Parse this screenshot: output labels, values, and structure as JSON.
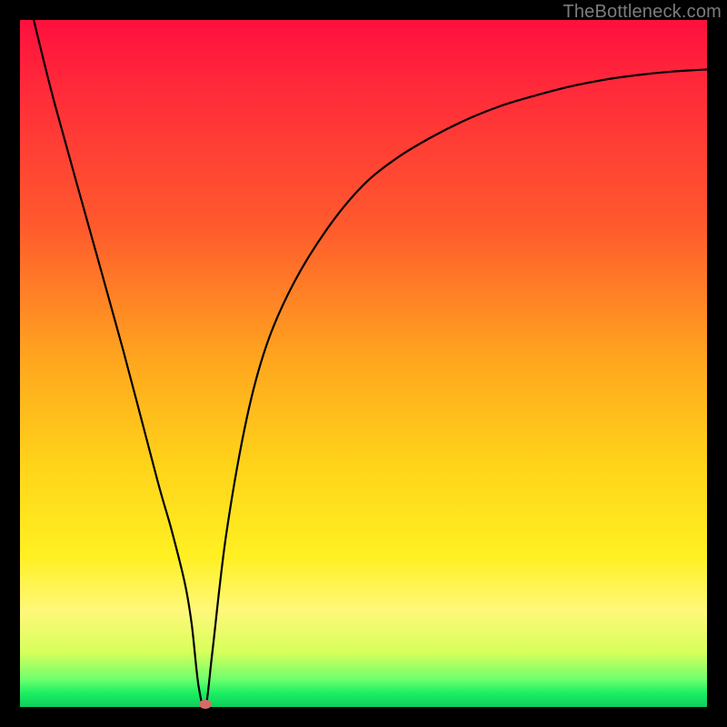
{
  "watermark": "TheBottleneck.com",
  "chart_data": {
    "type": "line",
    "title": "",
    "xlabel": "",
    "ylabel": "",
    "xlim": [
      0,
      100
    ],
    "ylim": [
      0,
      100
    ],
    "curve": {
      "x": [
        2,
        5,
        10,
        15,
        20,
        22,
        24,
        25,
        26,
        27,
        28,
        30,
        33,
        36,
        40,
        45,
        50,
        55,
        60,
        65,
        70,
        75,
        80,
        85,
        90,
        95,
        100
      ],
      "y": [
        100,
        88,
        70,
        52,
        33,
        26,
        18,
        12,
        3,
        0,
        8,
        25,
        42,
        53,
        62,
        70,
        76,
        80,
        83,
        85.5,
        87.5,
        89,
        90.3,
        91.3,
        92,
        92.5,
        92.8
      ]
    },
    "marker": {
      "x": 27,
      "y": 0
    },
    "gradient_stops": [
      {
        "pos": 0,
        "color": "#ff103e"
      },
      {
        "pos": 50,
        "color": "#ffa81e"
      },
      {
        "pos": 78,
        "color": "#fff022"
      },
      {
        "pos": 100,
        "color": "#0ccf5d"
      }
    ]
  }
}
